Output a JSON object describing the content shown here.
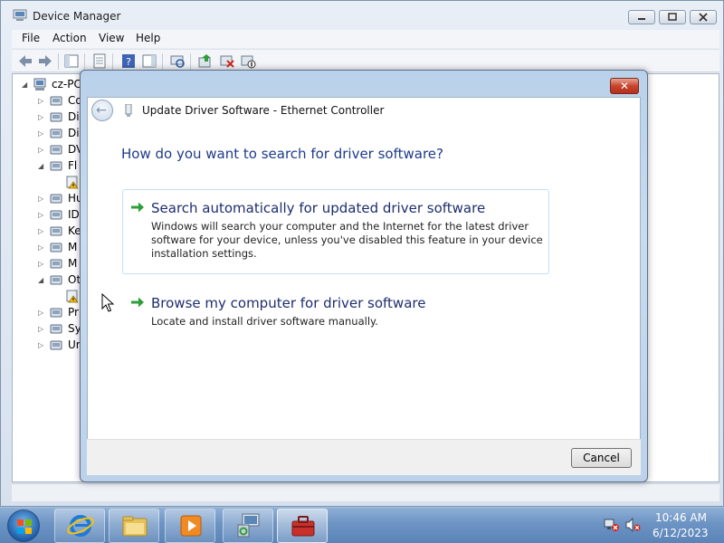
{
  "window": {
    "title": "Device Manager",
    "menu": [
      "File",
      "Action",
      "View",
      "Help"
    ]
  },
  "tree": {
    "root": "cz-PC",
    "items": [
      {
        "label": "Co",
        "icon": "computer-icon"
      },
      {
        "label": "Di",
        "icon": "disk-drive-icon"
      },
      {
        "label": "Di",
        "icon": "display-adapter-icon"
      },
      {
        "label": "DV",
        "icon": "dvd-drive-icon"
      },
      {
        "label": "Fl",
        "icon": "floppy-controller-icon"
      },
      {
        "label": "",
        "icon": "warning-device-icon"
      },
      {
        "label": "Hu",
        "icon": "hid-icon"
      },
      {
        "label": "ID",
        "icon": "ide-controller-icon"
      },
      {
        "label": "Ke",
        "icon": "keyboard-icon"
      },
      {
        "label": "M",
        "icon": "mouse-icon"
      },
      {
        "label": "M",
        "icon": "monitor-icon"
      },
      {
        "label": "Ot",
        "icon": "other-devices-icon"
      },
      {
        "label": "",
        "icon": "warning-device-icon"
      },
      {
        "label": "Pr",
        "icon": "processor-icon"
      },
      {
        "label": "Sy",
        "icon": "system-devices-icon"
      },
      {
        "label": "Ur",
        "icon": "usb-controller-icon"
      }
    ]
  },
  "dialog": {
    "title": "Update Driver Software - Ethernet Controller",
    "heading": "How do you want to search for driver software?",
    "options": [
      {
        "title": "Search automatically for updated driver software",
        "description": "Windows will search your computer and the Internet for the latest driver software for your device, unless you've disabled this feature in your device installation settings."
      },
      {
        "title": "Browse my computer for driver software",
        "description": "Locate and install driver software manually."
      }
    ],
    "cancel_label": "Cancel",
    "close_glyph": "✕"
  },
  "taskbar": {
    "time": "10:46 AM",
    "date": "6/12/2023"
  },
  "colors": {
    "heading": "#1e3b8a",
    "option_title": "#1e2e6e",
    "arrow_green": "#2e9e3a",
    "close_red": "#c8442d"
  }
}
